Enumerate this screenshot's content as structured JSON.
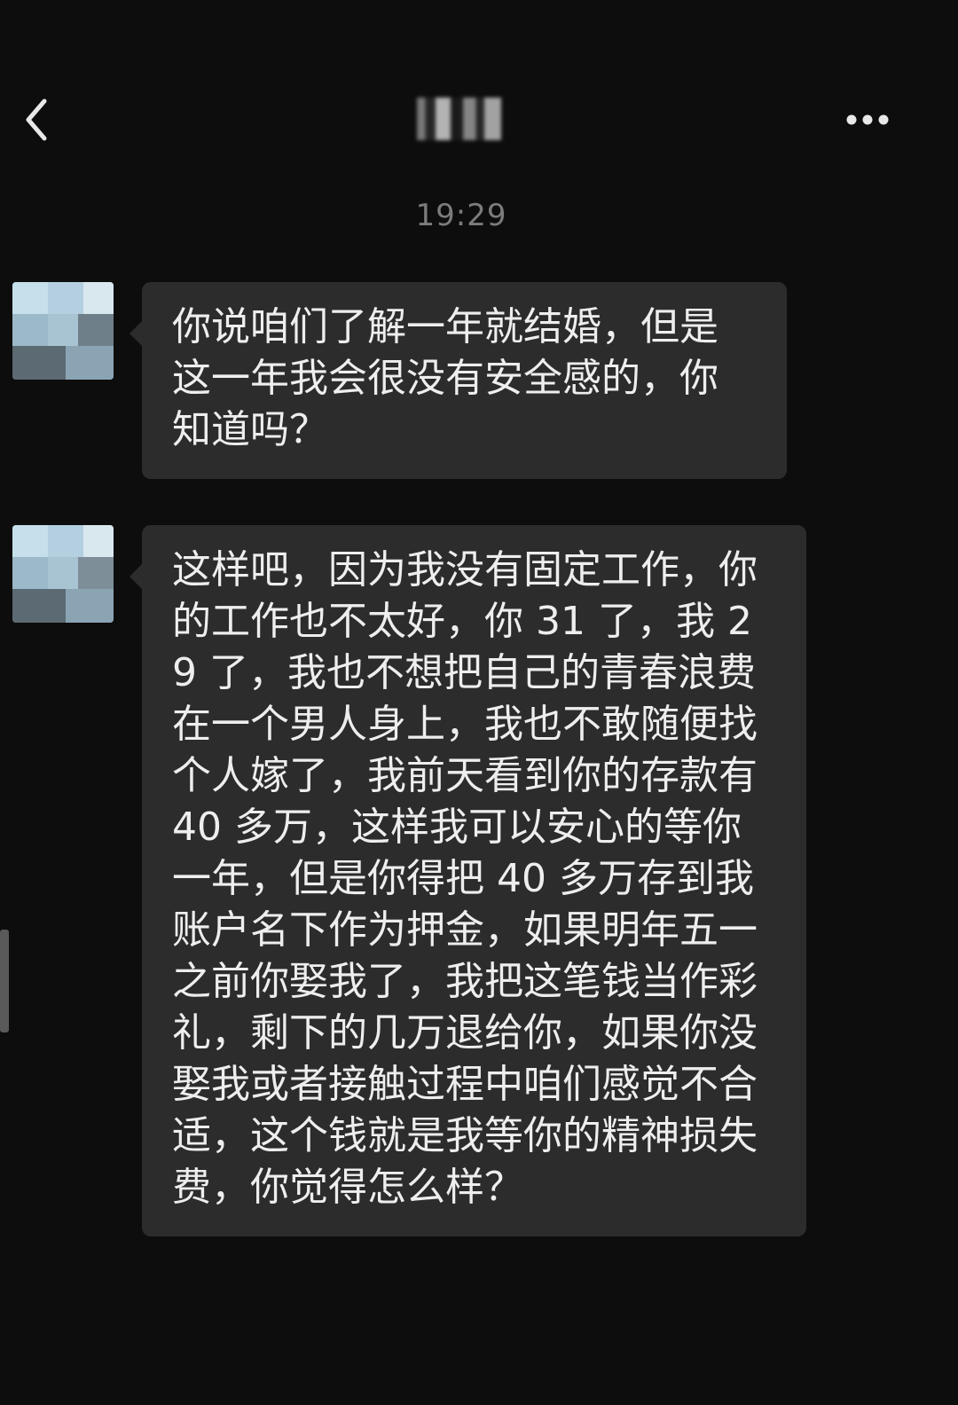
{
  "header": {
    "title": "",
    "back_icon": "chevron-left-icon",
    "more_icon": "more-horizontal-icon"
  },
  "timestamp": "19:29",
  "messages": [
    {
      "sender": "other",
      "text": "你说咱们了解一年就结婚，但是这一年我会很没有安全感的，你知道吗？"
    },
    {
      "sender": "other",
      "text": "这样吧，因为我没有固定工作，你的工作也不太好，你 31 了，我 29 了，我也不想把自己的青春浪费在一个男人身上，我也不敢随便找个人嫁了，我前天看到你的存款有 40 多万，这样我可以安心的等你一年，但是你得把 40 多万存到我账户名下作为押金，如果明年五一之前你娶我了，我把这笔钱当作彩礼，剩下的几万退给你，如果你没娶我或者接触过程中咱们感觉不合适，这个钱就是我等你的精神损失费，你觉得怎么样？"
    }
  ],
  "colors": {
    "background": "#0d0d0d",
    "bubble": "#2c2c2c",
    "text": "#eeeeee",
    "timestamp": "#7c7c7c"
  }
}
